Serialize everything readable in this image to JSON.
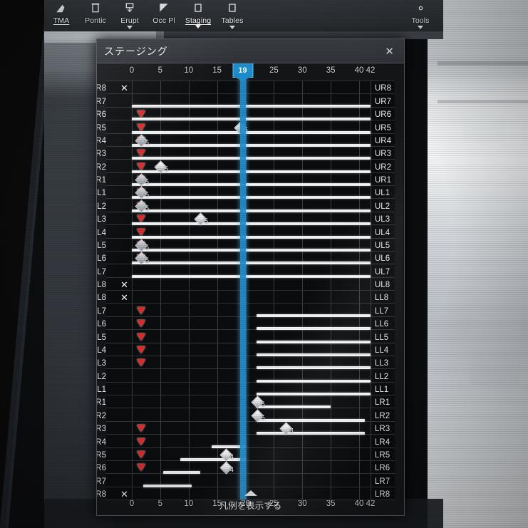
{
  "toolbar": {
    "items": [
      {
        "label": "TMA",
        "icon": "tma-icon",
        "active": true,
        "caret": false
      },
      {
        "label": "Pontic",
        "icon": "pontic-icon",
        "active": false,
        "caret": false
      },
      {
        "label": "Erupt",
        "icon": "erupt-icon",
        "active": false,
        "caret": true
      },
      {
        "label": "Occ Pl",
        "icon": "occlusal-plane-icon",
        "active": false,
        "caret": false
      },
      {
        "label": "Staging",
        "icon": "staging-icon",
        "active": true,
        "caret": true
      },
      {
        "label": "Tables",
        "icon": "tables-icon",
        "active": false,
        "caret": true
      }
    ],
    "tools": {
      "label": "Tools",
      "icon": "gear-icon",
      "caret": true
    }
  },
  "dialog": {
    "title": "ステージング",
    "close_label": "✕",
    "legend_toggle_label": "凡例を表示する",
    "cursor_value": "19",
    "accent_color": "#1f8fd0",
    "marker_red": "#e02b2b",
    "bar_color": "#f2f4f6"
  },
  "axis": {
    "ticks": [
      {
        "label": "0",
        "value": 0
      },
      {
        "label": "5",
        "value": 5
      },
      {
        "label": "10",
        "value": 10
      },
      {
        "label": "15",
        "value": 15
      },
      {
        "label": "20",
        "value": 20
      },
      {
        "label": "25",
        "value": 25
      },
      {
        "label": "30",
        "value": 30
      },
      {
        "label": "35",
        "value": 35
      },
      {
        "label": "40",
        "value": 40
      },
      {
        "label": "42",
        "value": 42
      }
    ],
    "min": 0,
    "max": 42
  },
  "chart_data": {
    "type": "bar",
    "title": "ステージング",
    "xlabel": "",
    "ylabel": "",
    "xlim": [
      0,
      42
    ],
    "grid": true,
    "cursor": 19,
    "rows": [
      {
        "label": "UR8",
        "xmark": true,
        "triangle": null,
        "diamond": null,
        "diamond_label": null,
        "bar": null
      },
      {
        "label": "UR7",
        "xmark": false,
        "triangle": null,
        "diamond": null,
        "diamond_label": null,
        "bar": [
          0,
          42
        ]
      },
      {
        "label": "UR6",
        "xmark": false,
        "triangle": 1.6,
        "diamond": null,
        "diamond_label": null,
        "bar": [
          0,
          42
        ]
      },
      {
        "label": "UR5",
        "xmark": false,
        "triangle": 1.6,
        "diamond": 19,
        "diamond_label": "5",
        "bar": [
          0,
          42
        ]
      },
      {
        "label": "UR4",
        "xmark": false,
        "triangle": 1.6,
        "diamond": 1.6,
        "diamond_label": "5",
        "bar": [
          0,
          42
        ]
      },
      {
        "label": "UR3",
        "xmark": false,
        "triangle": 1.6,
        "diamond": null,
        "diamond_label": null,
        "bar": [
          0,
          42
        ]
      },
      {
        "label": "UR2",
        "xmark": false,
        "triangle": 1.6,
        "diamond": 5,
        "diamond_label": "5",
        "bar": [
          0,
          42
        ]
      },
      {
        "label": "UR1",
        "xmark": false,
        "triangle": 1.6,
        "diamond": 1.6,
        "diamond_label": "5",
        "bar": [
          0,
          42
        ]
      },
      {
        "label": "UL1",
        "xmark": false,
        "triangle": 1.6,
        "diamond": 1.6,
        "diamond_label": "5",
        "bar": [
          0,
          42
        ]
      },
      {
        "label": "UL2",
        "xmark": false,
        "triangle": 1.6,
        "diamond": 1.6,
        "diamond_label": "5",
        "bar": [
          0,
          42
        ]
      },
      {
        "label": "UL3",
        "xmark": false,
        "triangle": 1.6,
        "diamond": 12,
        "diamond_label": "5",
        "bar": [
          0,
          42
        ]
      },
      {
        "label": "UL4",
        "xmark": false,
        "triangle": 1.6,
        "diamond": null,
        "diamond_label": null,
        "bar": [
          0,
          42
        ]
      },
      {
        "label": "UL5",
        "xmark": false,
        "triangle": 1.6,
        "diamond": 1.6,
        "diamond_label": "5",
        "bar": [
          0,
          42
        ]
      },
      {
        "label": "UL6",
        "xmark": false,
        "triangle": 1.6,
        "diamond": 1.6,
        "diamond_label": "5",
        "bar": [
          0,
          42
        ]
      },
      {
        "label": "UL7",
        "xmark": false,
        "triangle": null,
        "diamond": null,
        "diamond_label": null,
        "bar": [
          0,
          42
        ]
      },
      {
        "label": "UL8",
        "xmark": true,
        "triangle": null,
        "diamond": null,
        "diamond_label": null,
        "bar": null
      },
      {
        "label": "LL8",
        "xmark": true,
        "triangle": null,
        "diamond": null,
        "diamond_label": null,
        "bar": null
      },
      {
        "label": "LL7",
        "xmark": false,
        "triangle": 1.6,
        "diamond": null,
        "diamond_label": null,
        "bar": [
          22,
          42
        ]
      },
      {
        "label": "LL6",
        "xmark": false,
        "triangle": 1.6,
        "diamond": null,
        "diamond_label": null,
        "bar": [
          22,
          42
        ]
      },
      {
        "label": "LL5",
        "xmark": false,
        "triangle": 1.6,
        "diamond": null,
        "diamond_label": null,
        "bar": [
          22,
          42
        ]
      },
      {
        "label": "LL4",
        "xmark": false,
        "triangle": 1.6,
        "diamond": null,
        "diamond_label": null,
        "bar": [
          22,
          42
        ]
      },
      {
        "label": "LL3",
        "xmark": false,
        "triangle": 1.6,
        "diamond": null,
        "diamond_label": null,
        "bar": [
          22,
          42
        ]
      },
      {
        "label": "LL2",
        "xmark": false,
        "triangle": null,
        "diamond": null,
        "diamond_label": null,
        "bar": [
          22,
          42
        ]
      },
      {
        "label": "LL1",
        "xmark": false,
        "triangle": null,
        "diamond": null,
        "diamond_label": null,
        "bar": [
          22,
          42
        ]
      },
      {
        "label": "LR1",
        "xmark": false,
        "triangle": null,
        "diamond": 22,
        "diamond_label": "5",
        "bar": [
          22,
          35
        ]
      },
      {
        "label": "LR2",
        "xmark": false,
        "triangle": null,
        "diamond": 22,
        "diamond_label": "5",
        "bar": [
          22,
          41
        ]
      },
      {
        "label": "LR3",
        "xmark": false,
        "triangle": 1.6,
        "diamond": 27,
        "diamond_label": "3",
        "bar": [
          22,
          41
        ]
      },
      {
        "label": "LR4",
        "xmark": false,
        "triangle": 1.6,
        "diamond": null,
        "diamond_label": null,
        "bar": [
          14,
          20
        ]
      },
      {
        "label": "LR5",
        "xmark": false,
        "triangle": 1.6,
        "diamond": 16.5,
        "diamond_label": "4",
        "bar": [
          8.5,
          20
        ]
      },
      {
        "label": "LR6",
        "xmark": false,
        "triangle": 1.6,
        "diamond": 16.5,
        "diamond_label": "4",
        "bar": [
          5.5,
          12
        ]
      },
      {
        "label": "LR7",
        "xmark": false,
        "triangle": null,
        "diamond": null,
        "diamond_label": null,
        "bar": [
          2,
          10.5
        ]
      },
      {
        "label": "LR8",
        "xmark": true,
        "triangle": null,
        "diamond": null,
        "diamond_label": null,
        "bar": null
      }
    ]
  },
  "background": {
    "behind_text": "指示が白く重なる"
  }
}
